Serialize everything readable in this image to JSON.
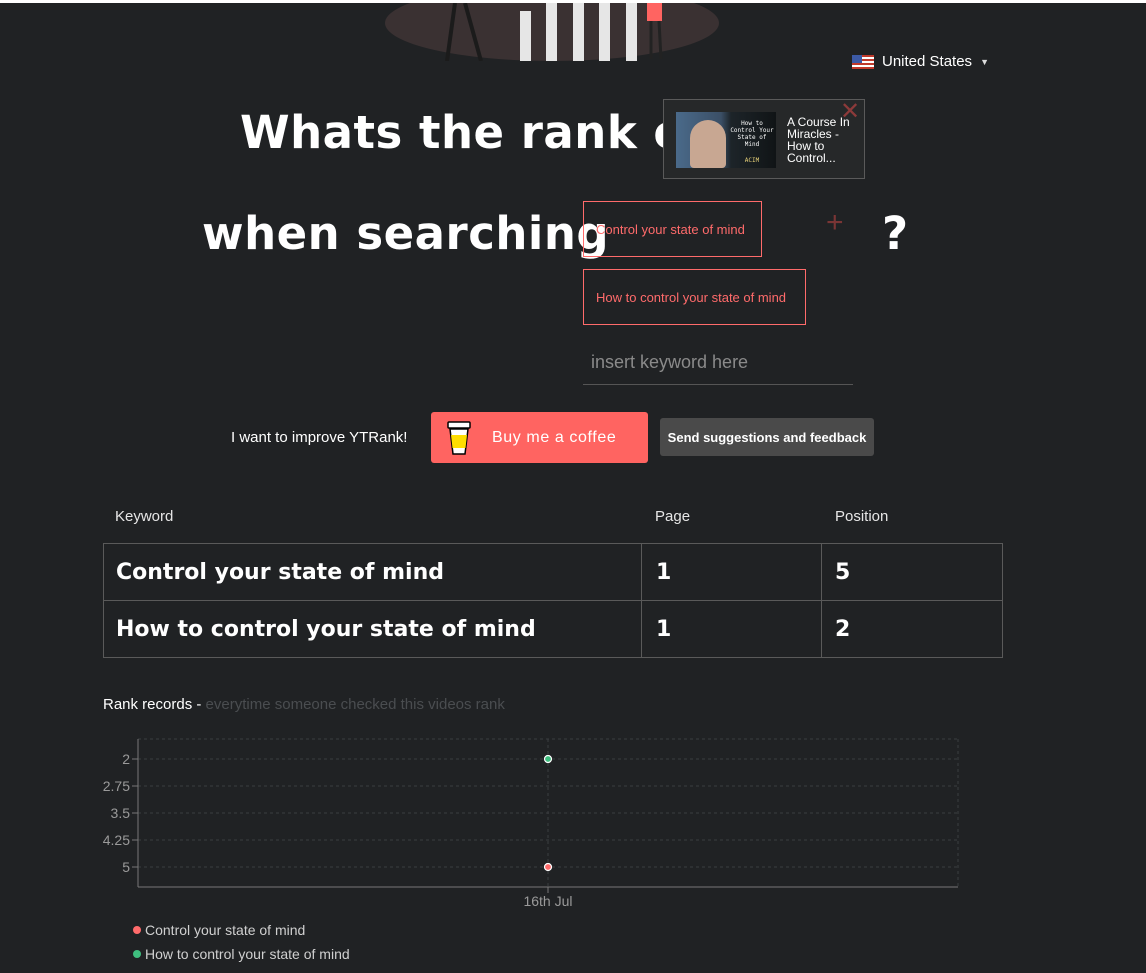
{
  "header": {
    "country": "United States",
    "title_line1": "Whats the rank of",
    "title_line2": "when searching",
    "question_mark": "?"
  },
  "video": {
    "title": "A Course In Miracles - How to Control...",
    "thumbnail_text": "How to Control Your State of Mind",
    "thumbnail_subtext": "ACIM"
  },
  "keywords": [
    "Control your state of mind",
    "How to control your state of mind"
  ],
  "keyword_input": {
    "placeholder": "insert keyword here"
  },
  "support": {
    "improve_text": "I want to improve YTRank!",
    "coffee_label": "Buy me a coffee",
    "feedback_label": "Send suggestions and feedback"
  },
  "table": {
    "headers": [
      "Keyword",
      "Page",
      "Position"
    ],
    "rows": [
      [
        "Control your state of mind",
        "1",
        "5"
      ],
      [
        "How to control your state of mind",
        "1",
        "2"
      ]
    ]
  },
  "rank_records": {
    "title": "Rank records -",
    "subtitle": "everytime someone checked this videos rank"
  },
  "chart_data": {
    "type": "scatter",
    "title": "",
    "xlabel": "",
    "ylabel": "",
    "categories": [
      "16th Jul"
    ],
    "y_ticks": [
      "2",
      "2.75",
      "3.5",
      "4.25",
      "5"
    ],
    "ylim": [
      2,
      5
    ],
    "y_reversed": true,
    "grid": true,
    "legend_position": "bottom-left",
    "series": [
      {
        "name": "Control your state of mind",
        "color": "#ff6b6b",
        "values": [
          5
        ]
      },
      {
        "name": "How to control your state of mind",
        "color": "#3fbf7f",
        "values": [
          2
        ]
      }
    ]
  },
  "colors": {
    "accent": "#ff6461",
    "background": "#202224",
    "chip": "#ff6b6b"
  },
  "icons": {
    "flag": "us-flag-icon",
    "close": "close-icon",
    "add": "plus-icon",
    "cup": "coffee-cup-icon",
    "caret": "caret-down-icon"
  }
}
